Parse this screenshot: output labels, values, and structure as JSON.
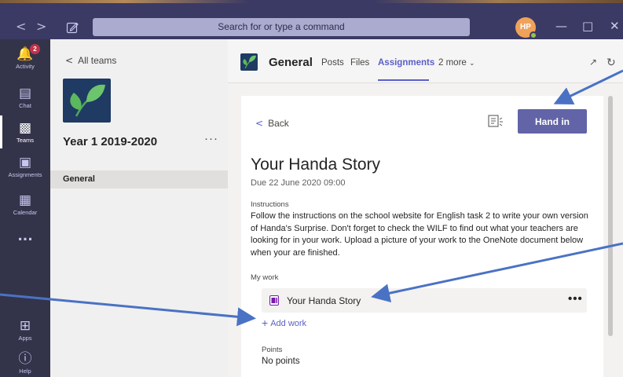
{
  "titlebar": {
    "search_placeholder": "Search for or type a command",
    "avatar_initials": "HP",
    "back_glyph": "<",
    "forward_glyph": ">",
    "minimize_glyph": "—",
    "maximize_glyph": "□",
    "close_glyph": "✕"
  },
  "rail": {
    "items": [
      {
        "label": "Activity",
        "icon": "bell-icon",
        "badge": "2"
      },
      {
        "label": "Chat",
        "icon": "chat-icon"
      },
      {
        "label": "Teams",
        "icon": "teams-icon"
      },
      {
        "label": "Assignments",
        "icon": "assignments-icon"
      },
      {
        "label": "Calendar",
        "icon": "calendar-icon"
      },
      {
        "label": "...",
        "icon": "more-icon"
      },
      {
        "label": "Apps",
        "icon": "apps-icon"
      },
      {
        "label": "Help",
        "icon": "help-icon"
      }
    ]
  },
  "teampanel": {
    "all_teams": "All teams",
    "team_name": "Year 1 2019-2020",
    "more": "···",
    "channel": "General"
  },
  "header": {
    "channel_name": "General",
    "tabs": [
      "Posts",
      "Files",
      "Assignments",
      "2 more"
    ],
    "active_tab": "Assignments"
  },
  "assignment": {
    "back_label": "Back",
    "hand_in_label": "Hand in",
    "title": "Your Handa Story",
    "due": "Due 22 June 2020 09:00",
    "instructions_label": "Instructions",
    "instructions": "Follow the instructions on the school website for English task 2 to write your own version of Handa's Surprise. Don't forget to check the WILF to find out what your teachers are looking for in your work. Upload a picture of your work to the OneNote document below when your are finished.",
    "my_work_label": "My work",
    "work_item": "Your Handa Story",
    "work_more": "•••",
    "add_work": "Add work",
    "points_label": "Points",
    "points_value": "No points"
  },
  "colors": {
    "titlebar": "#3b3a65",
    "rail": "#33344a",
    "accent": "#6264a7",
    "arrow": "#4a72c4"
  }
}
